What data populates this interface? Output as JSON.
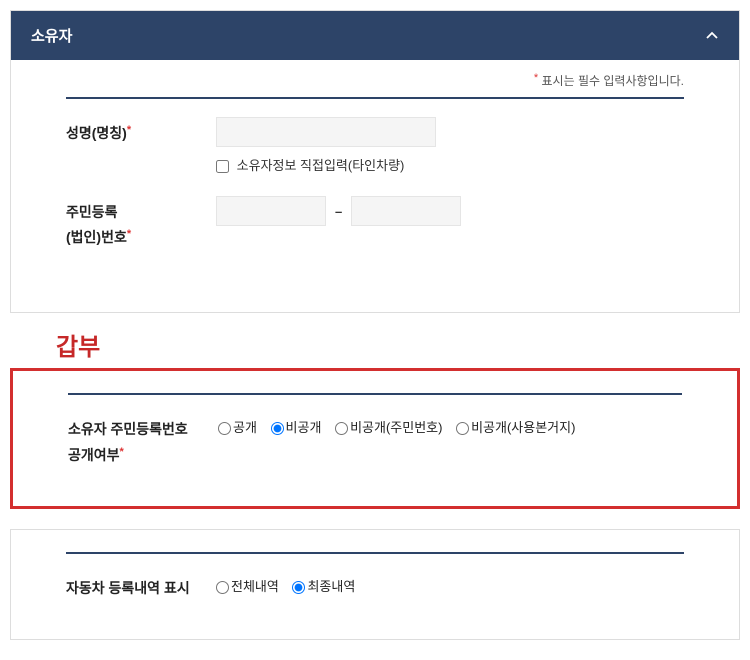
{
  "section1": {
    "title": "소유자",
    "required_note": "표시는 필수 입력사항입니다.",
    "name_label": "성명(명칭)",
    "direct_input_label": "소유자정보 직접입력(타인차량)",
    "rrn_label_line1": "주민등록",
    "rrn_label_line2": "(법인)번호",
    "dash": "–"
  },
  "annotation": "갑부",
  "section2": {
    "label_line1": "소유자 주민등록번호",
    "label_line2": "공개여부",
    "options": {
      "o1": "공개",
      "o2": "비공개",
      "o3": "비공개(주민번호)",
      "o4": "비공개(사용본거지)"
    }
  },
  "section3": {
    "label": "자동차 등록내역 표시",
    "options": {
      "o1": "전체내역",
      "o2": "최종내역"
    }
  }
}
